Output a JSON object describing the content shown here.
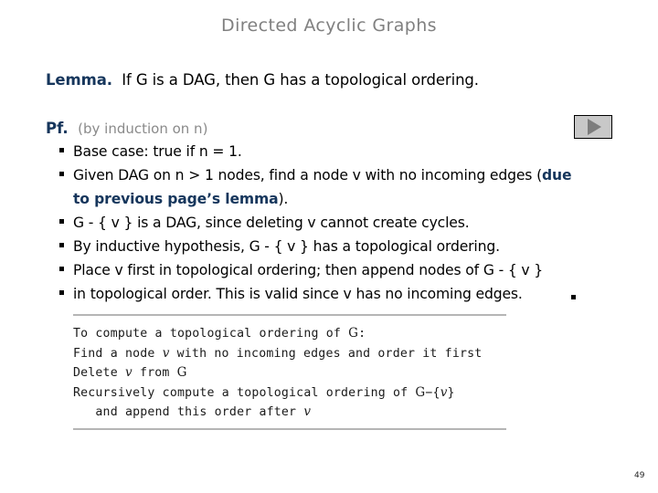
{
  "slide": {
    "title": "Directed Acyclic Graphs",
    "page_number": "49",
    "title_color": "#808080",
    "accent_blue": "#16365C"
  },
  "lemma": {
    "label": "Lemma.",
    "statement": "If G is a DAG, then G has a topological ordering."
  },
  "proof": {
    "label": "Pf.",
    "note": "(by induction on n)",
    "bullets": [
      {
        "marker": true,
        "segments": [
          {
            "text": "Base case:  true if n = 1.",
            "color": "black"
          }
        ]
      },
      {
        "marker": true,
        "segments": [
          {
            "text": "Given DAG on n > 1 nodes, find a node v with no incoming edges (",
            "color": "black"
          },
          {
            "text": "due",
            "color": "blue"
          }
        ]
      },
      {
        "marker": false,
        "segments": [
          {
            "text": "to previous page’s lemma",
            "color": "blue"
          },
          {
            "text": ").",
            "color": "black"
          }
        ]
      },
      {
        "marker": true,
        "segments": [
          {
            "text": "G - { v } is a DAG, since deleting v cannot create cycles.",
            "color": "black"
          }
        ]
      },
      {
        "marker": true,
        "segments": [
          {
            "text": "By inductive hypothesis, G - { v } has a topological ordering.",
            "color": "black"
          }
        ]
      },
      {
        "marker": true,
        "segments": [
          {
            "text": "Place v first in topological ordering; then append nodes of G - { v }",
            "color": "black"
          }
        ]
      },
      {
        "marker": true,
        "trailing_marker": true,
        "segments": [
          {
            "text": "in topological order. This is valid since v has no incoming edges.",
            "color": "black"
          }
        ]
      }
    ]
  },
  "play_button": {
    "name": "advance-animation-button",
    "icon": "play-triangle-icon"
  },
  "pseudocode": {
    "lines": [
      "To compute a topological ordering of G:",
      "Find a node v with no incoming edges and order it first",
      "Delete v from G",
      "Recursively compute a topological ordering of G−{v}",
      "   and append this order after v"
    ]
  }
}
